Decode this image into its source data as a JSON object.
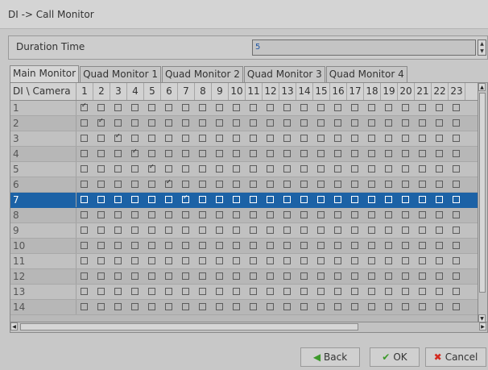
{
  "window": {
    "title": "DI -> Call Monitor"
  },
  "duration": {
    "label": "Duration Time",
    "value": "5"
  },
  "tabs": [
    "Main Monitor",
    "Quad Monitor 1",
    "Quad Monitor 2",
    "Quad Monitor 3",
    "Quad Monitor 4"
  ],
  "grid": {
    "corner_label": "DI \\ Camera",
    "cameras": [
      "1",
      "2",
      "3",
      "4",
      "5",
      "6",
      "7",
      "8",
      "9",
      "10",
      "11",
      "12",
      "13",
      "14",
      "15",
      "16",
      "17",
      "18",
      "19",
      "20",
      "21",
      "22",
      "23"
    ],
    "rows": [
      {
        "label": "1",
        "checked": [
          1
        ]
      },
      {
        "label": "2",
        "checked": [
          2
        ]
      },
      {
        "label": "3",
        "checked": [
          3
        ]
      },
      {
        "label": "4",
        "checked": [
          4
        ]
      },
      {
        "label": "5",
        "checked": [
          5
        ]
      },
      {
        "label": "6",
        "checked": [
          6
        ]
      },
      {
        "label": "7",
        "checked": [
          7
        ],
        "selected": true
      },
      {
        "label": "8",
        "checked": []
      },
      {
        "label": "9",
        "checked": []
      },
      {
        "label": "10",
        "checked": []
      },
      {
        "label": "11",
        "checked": []
      },
      {
        "label": "12",
        "checked": []
      },
      {
        "label": "13",
        "checked": []
      },
      {
        "label": "14",
        "checked": []
      }
    ]
  },
  "buttons": {
    "back": "Back",
    "ok": "OK",
    "cancel": "Cancel"
  },
  "colors": {
    "selected_row": "#1c62a6",
    "back_icon": "#3d9a2b",
    "ok_icon": "#3d9a2b",
    "cancel_icon": "#d42a1f"
  }
}
